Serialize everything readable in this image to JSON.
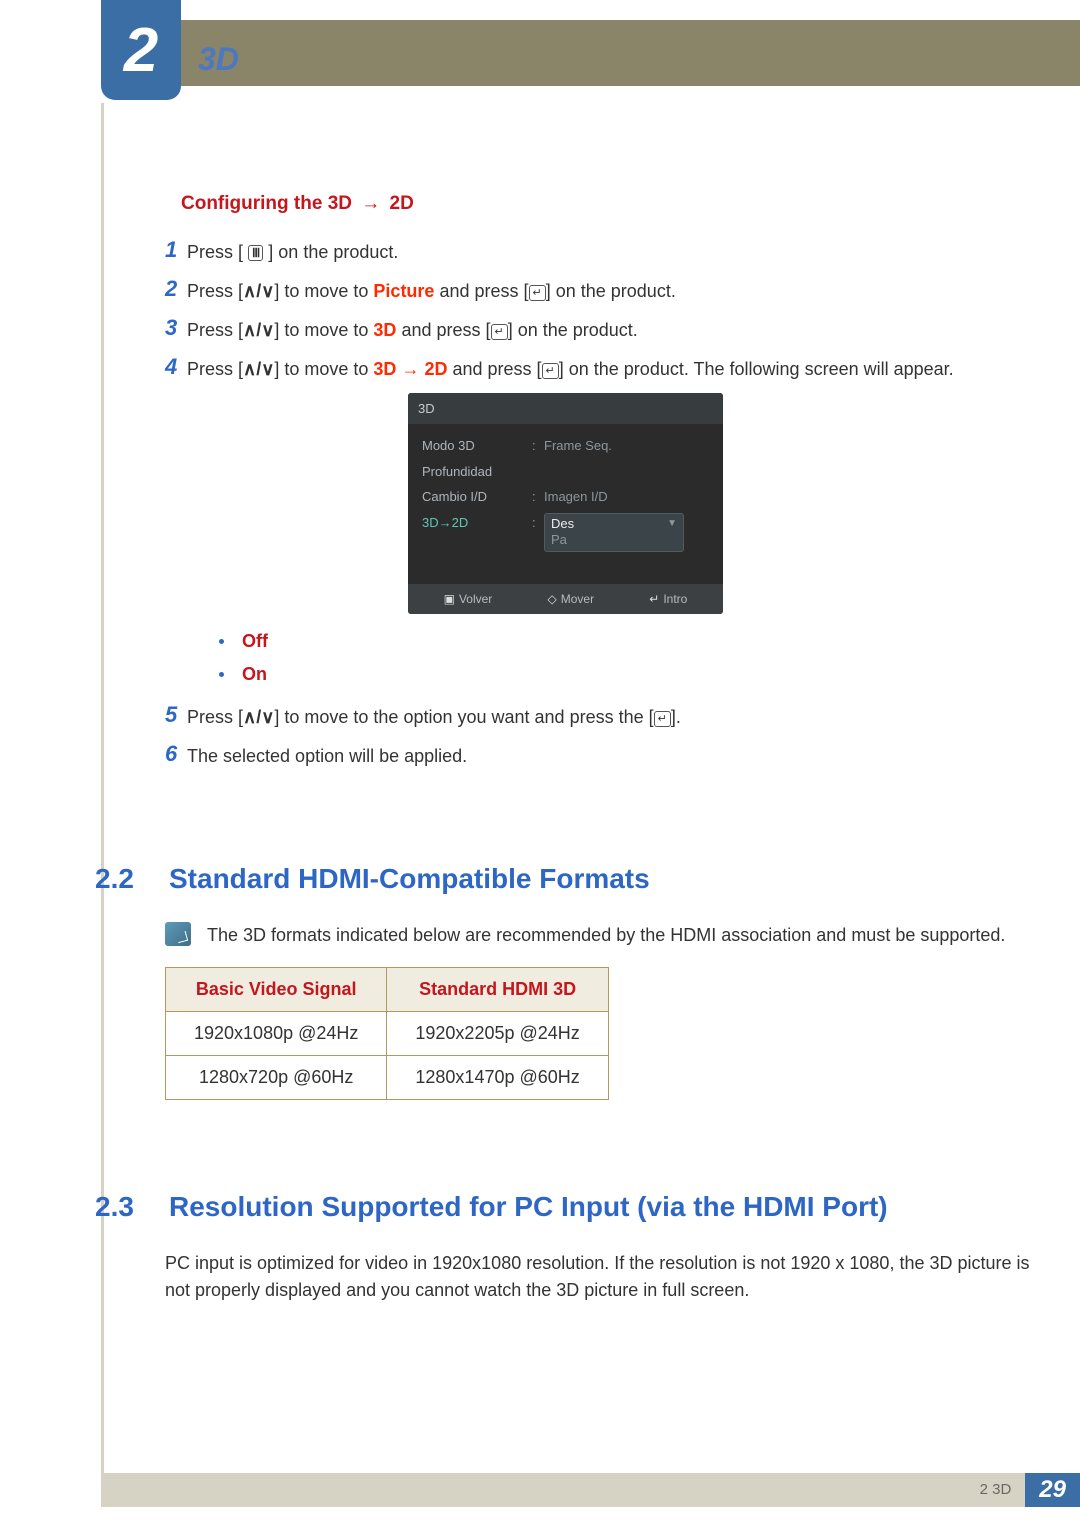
{
  "header": {
    "chapter_number": "2",
    "chapter_title": "3D"
  },
  "subheading": {
    "prefix": "Configuring the 3D",
    "arrow": "→",
    "suffix": "2D"
  },
  "icons": {
    "menu": "𝗠",
    "updown": "∧/∨",
    "enter": "↵"
  },
  "steps": {
    "s1": {
      "n": "1",
      "text_a": "Press [ ",
      "text_b": " ] on the product."
    },
    "s2": {
      "n": "2",
      "a": "Press [",
      "b": "] to move to ",
      "hl": "Picture",
      "c": " and press [",
      "d": "] on the product."
    },
    "s3": {
      "n": "3",
      "a": "Press [",
      "b": "] to move to ",
      "hl": "3D",
      "c": " and press [",
      "d": "] on the product."
    },
    "s4": {
      "n": "4",
      "a": "Press [",
      "b": "] to move to ",
      "hl1": "3D",
      "arrow": " → ",
      "hl2": "2D",
      "c": " and press [",
      "d": "] on the product. The following screen will appear."
    },
    "s5": {
      "n": "5",
      "a": "Press [",
      "b": "] to move to the option you want and press the [",
      "c": "]."
    },
    "s6": {
      "n": "6",
      "text": "The selected option will be applied."
    }
  },
  "osd": {
    "title": "3D",
    "rows": {
      "r1": {
        "label": "Modo 3D",
        "value": "Frame Seq."
      },
      "r2": {
        "label": "Profundidad",
        "value": ""
      },
      "r3": {
        "label": "Cambio I/D",
        "value": "Imagen I/D"
      },
      "r4": {
        "label": "3D→2D",
        "sel": "Des",
        "alt": "Pa"
      }
    },
    "bar": {
      "b1_icon": "▣",
      "b1": "Volver",
      "b2_icon": "◇",
      "b2": "Mover",
      "b3_icon": "↵",
      "b3": "Intro"
    }
  },
  "bullets": {
    "b1": "Off",
    "b2": "On"
  },
  "section22": {
    "num": "2.2",
    "title": "Standard HDMI-Compatible Formats",
    "note": "The 3D formats indicated below are recommended by the HDMI association and must be supported.",
    "table": {
      "h1": "Basic Video Signal",
      "h2": "Standard HDMI 3D",
      "r1c1": "1920x1080p @24Hz",
      "r1c2": "1920x2205p @24Hz",
      "r2c1": "1280x720p @60Hz",
      "r2c2": "1280x1470p @60Hz"
    }
  },
  "section23": {
    "num": "2.3",
    "title": "Resolution Supported for PC Input (via the HDMI Port)",
    "para": "PC input is optimized for video in 1920x1080 resolution. If the resolution is not 1920 x 1080, the 3D picture is not properly displayed and you cannot watch the 3D picture in full screen."
  },
  "footer": {
    "crumb": "2 3D",
    "page": "29"
  }
}
